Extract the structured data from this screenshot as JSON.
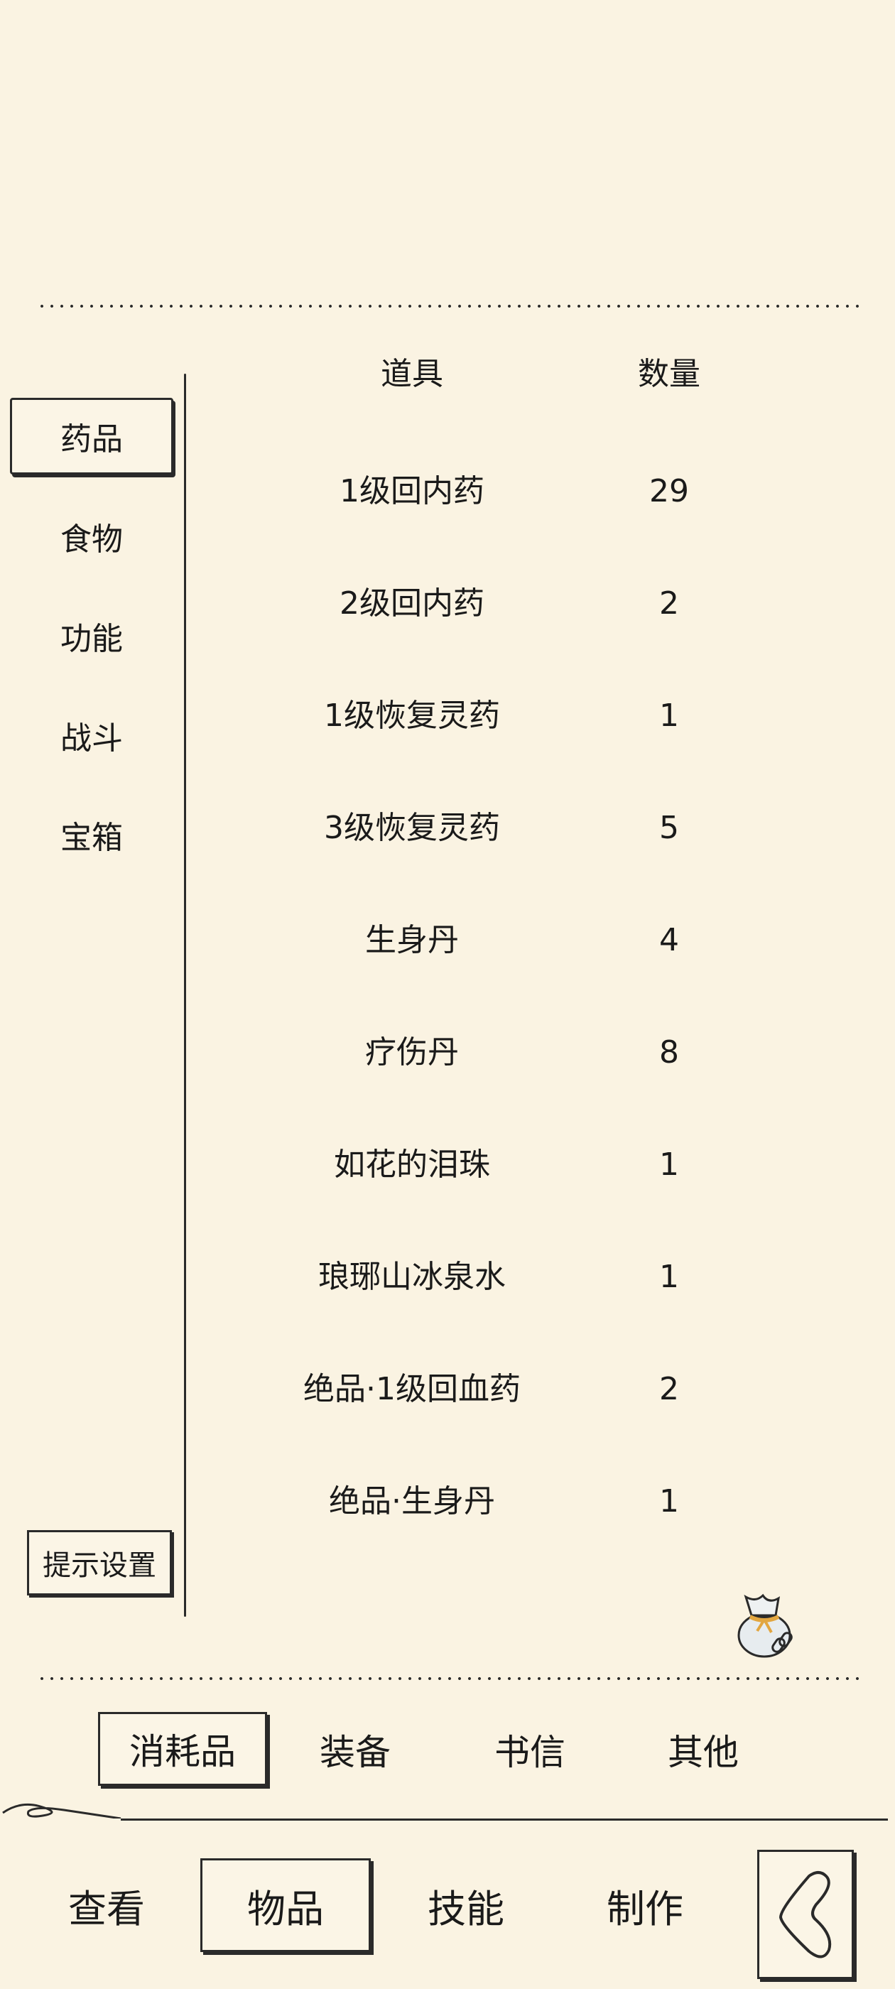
{
  "table": {
    "header_name": "道具",
    "header_qty": "数量",
    "items": [
      {
        "name": "1级回内药",
        "qty": "29"
      },
      {
        "name": "2级回内药",
        "qty": "2"
      },
      {
        "name": "1级恢复灵药",
        "qty": "1"
      },
      {
        "name": "3级恢复灵药",
        "qty": "5"
      },
      {
        "name": "生身丹",
        "qty": "4"
      },
      {
        "name": "疗伤丹",
        "qty": "8"
      },
      {
        "name": "如花的泪珠",
        "qty": "1"
      },
      {
        "name": "琅琊山冰泉水",
        "qty": "1"
      },
      {
        "name": "绝品·1级回血药",
        "qty": "2"
      },
      {
        "name": "绝品·生身丹",
        "qty": "1"
      }
    ]
  },
  "categories": {
    "items": [
      "药品",
      "食物",
      "功能",
      "战斗",
      "宝箱"
    ],
    "selected": "药品"
  },
  "hint_settings_label": "提示设置",
  "bag_icon": "item-bag-icon",
  "tabs": {
    "items": [
      "消耗品",
      "装备",
      "书信",
      "其他"
    ],
    "selected": "消耗品"
  },
  "nav": {
    "items": [
      "查看",
      "物品",
      "技能",
      "制作"
    ],
    "selected": "物品",
    "back_icon": "back-arrow-icon"
  }
}
